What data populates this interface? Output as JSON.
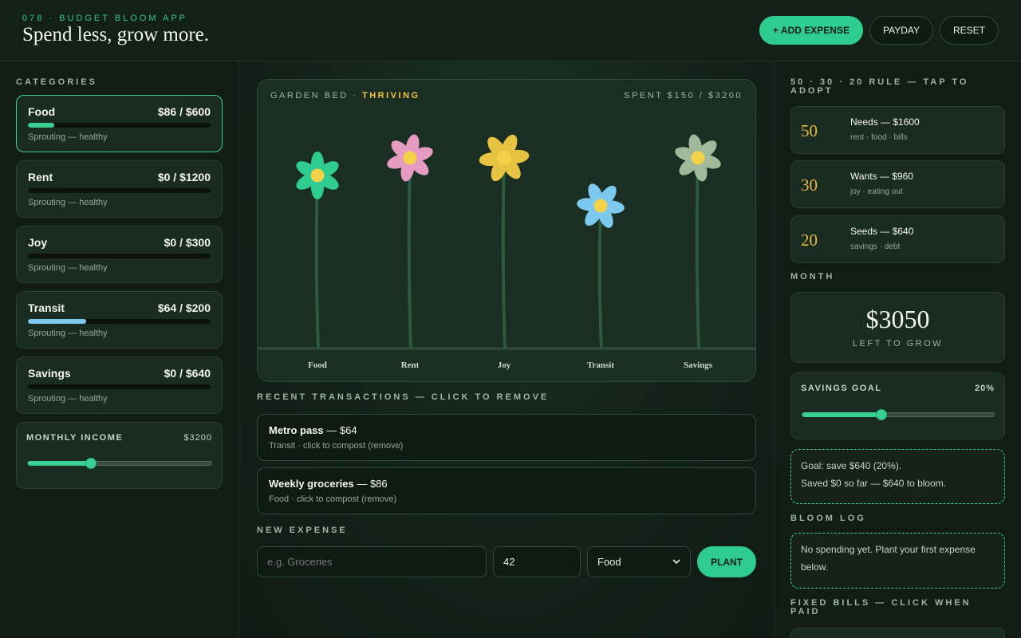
{
  "app": {
    "kicker": "078 · BUDGET BLOOM APP",
    "title": "Spend less, grow more."
  },
  "header": {
    "add_label": "+ ADD EXPENSE",
    "payday_label": "PAYDAY",
    "reset_label": "RESET"
  },
  "left": {
    "categories_heading": "CATEGORIES",
    "categories": [
      {
        "name": "Food",
        "amount": "$86 / $600",
        "fill": 0.143,
        "color": "#3bd093",
        "status": "Sprouting — healthy"
      },
      {
        "name": "Rent",
        "amount": "$0 / $1200",
        "fill": 0,
        "color": "#3bd093",
        "status": "Sprouting — healthy"
      },
      {
        "name": "Joy",
        "amount": "$0 / $300",
        "fill": 0,
        "color": "#3bd093",
        "status": "Sprouting — healthy"
      },
      {
        "name": "Transit",
        "amount": "$64 / $200",
        "fill": 0.32,
        "color": "#7cc8ee",
        "status": "Sprouting — healthy"
      },
      {
        "name": "Savings",
        "amount": "$0 / $640",
        "fill": 0,
        "color": "#3bd093",
        "status": "Sprouting — healthy"
      }
    ],
    "income_label": "MONTHLY INCOME",
    "income_value": "$3200",
    "income_slider": 0.34
  },
  "garden": {
    "label": "GARDEN BED · ",
    "state": "THRIVING",
    "spent": "SPENT $150 / $3200",
    "flowers": [
      {
        "label": "Food",
        "petal": "#2fcc8f"
      },
      {
        "label": "Rent",
        "petal": "#e69cc0"
      },
      {
        "label": "Joy",
        "petal": "#e6c340"
      },
      {
        "label": "Transit",
        "petal": "#7cc8ee"
      },
      {
        "label": "Savings",
        "petal": "#9fb99a"
      }
    ]
  },
  "transactions": {
    "heading": "RECENT TRANSACTIONS — CLICK TO REMOVE",
    "items": [
      {
        "name": "Metro pass",
        "amount": " — $64",
        "sub": "Transit · click to compost (remove)"
      },
      {
        "name": "Weekly groceries",
        "amount": " — $86",
        "sub": "Food · click to compost (remove)"
      }
    ]
  },
  "new_expense": {
    "heading": "NEW EXPENSE",
    "name_placeholder": "e.g. Groceries",
    "amount_value": "42",
    "category_value": "Food",
    "plant_label": "PLANT"
  },
  "rule": {
    "heading": "50 · 30 · 20 RULE — TAP TO ADOPT",
    "items": [
      {
        "pct": "50",
        "title": "Needs — $1600",
        "sub": "rent · food · bills"
      },
      {
        "pct": "30",
        "title": "Wants — $960",
        "sub": "joy · eating out"
      },
      {
        "pct": "20",
        "title": "Seeds — $640",
        "sub": "savings · debt"
      }
    ]
  },
  "month": {
    "heading": "MONTH",
    "value": "$3050",
    "caption": "LEFT TO GROW"
  },
  "savings": {
    "label": "SAVINGS GOAL",
    "pct": "20%",
    "slider": 0.41,
    "goal_line1": "Goal: save $640 (20%).",
    "goal_line2": "Saved $0 so far — $640 to bloom."
  },
  "bloom_log": {
    "heading": "BLOOM LOG",
    "text": "No spending yet. Plant your first expense below."
  },
  "fixed_bills": {
    "heading": "FIXED BILLS — CLICK WHEN PAID"
  },
  "colors": {
    "accent": "#2fcc8f",
    "gold": "#e9b949",
    "bg": "#0f1a15"
  }
}
